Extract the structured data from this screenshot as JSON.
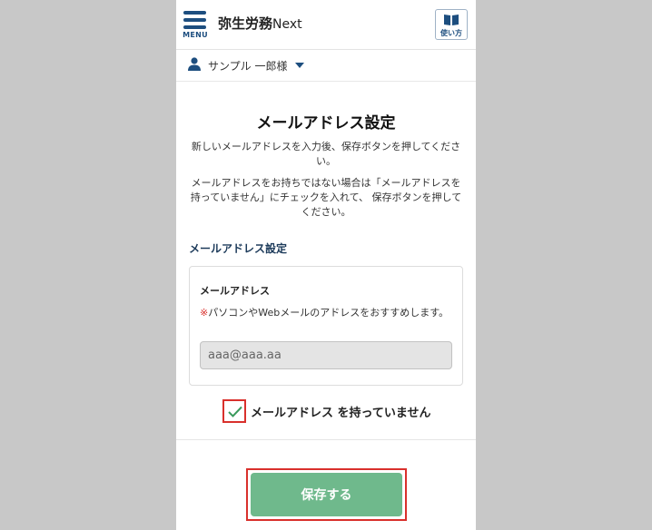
{
  "header": {
    "menu_label": "MENU",
    "app_title": "弥生労務",
    "app_title_suffix": "Next",
    "help_label": "使い方"
  },
  "user": {
    "name": "サンプル 一郎様"
  },
  "page": {
    "title": "メールアドレス設定",
    "description": [
      "新しいメールアドレスを入力後、保存ボタンを押してください。",
      "メールアドレスをお持ちではない場合は「メールアドレスを持っていません」にチェックを入れて、 保存ボタンを押してください。"
    ]
  },
  "form": {
    "section_heading": "メールアドレス設定",
    "field_label": "メールアドレス",
    "note_mark": "※",
    "note_text": "パソコンやWebメールのアドレスをおすすめします。",
    "email_value": "aaa@aaa.aa",
    "no_email_checked": true,
    "no_email_label": "メールアドレス を持っていません",
    "save_label": "保存する"
  },
  "colors": {
    "brand": "#1d4e7f",
    "save_button": "#6fb98c",
    "highlight": "#d9302c",
    "check": "#3a9a5c"
  }
}
